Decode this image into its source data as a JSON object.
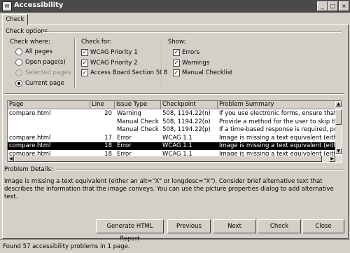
{
  "window": {
    "title": "Accessibility",
    "app_icon_text": "W",
    "controls": [
      "_",
      "□",
      "×"
    ]
  },
  "tab": {
    "label": "Check"
  },
  "check_options": {
    "header": "Check options",
    "check_where": {
      "header": "Check where:",
      "options": [
        {
          "label": "All pages",
          "selected": false,
          "enabled": true
        },
        {
          "label": "Open page(s)",
          "selected": false,
          "enabled": true
        },
        {
          "label": "Selected pages",
          "selected": false,
          "enabled": false
        },
        {
          "label": "Current page",
          "selected": true,
          "enabled": true
        }
      ]
    },
    "check_for": {
      "header": "Check for:",
      "options": [
        {
          "label": "WCAG Priority 1",
          "checked": true
        },
        {
          "label": "WCAG Priority 2",
          "checked": true
        },
        {
          "label": "Access Board Section 508",
          "checked": true
        }
      ]
    },
    "show": {
      "header": "Show:",
      "options": [
        {
          "label": "Errors",
          "checked": true
        },
        {
          "label": "Warnings",
          "checked": true
        },
        {
          "label": "Manual Checklist",
          "checked": true
        }
      ]
    }
  },
  "results": {
    "columns": [
      "Page",
      "Line",
      "Issue Type",
      "Checkpoint",
      "Problem Summary"
    ],
    "rows": [
      {
        "page": "compare.html",
        "line": "20",
        "issue": "Warning",
        "checkpoint": "508, 1194.22(n)",
        "summary": "If you use electronic forms, ensure that they ca",
        "selected": false
      },
      {
        "page": "",
        "line": "",
        "issue": "Manual Check",
        "checkpoint": "508, 1194.22(o)",
        "summary": "Provide a method for the user to skip these repe",
        "selected": false
      },
      {
        "page": "",
        "line": "",
        "issue": "Manual Check",
        "checkpoint": "508, 1194.22(p)",
        "summary": "If a time-based response is required, provide an",
        "selected": false
      },
      {
        "page": "compare.html",
        "line": "17",
        "issue": "Error",
        "checkpoint": "WCAG 1.1",
        "summary": "Image is missing a text equivalent (either an alt=",
        "selected": false
      },
      {
        "page": "compare.html",
        "line": "18",
        "issue": "Error",
        "checkpoint": "WCAG 1.1",
        "summary": "Image is missing a text equivalent (either an alt=",
        "selected": true
      },
      {
        "page": "compare.html",
        "line": "18",
        "issue": "Error",
        "checkpoint": "WCAG 1.1",
        "summary": "Image is missing a text equivalent (either an alt=",
        "selected": false
      }
    ]
  },
  "details": {
    "header": "Problem Details:",
    "text": "Image is missing a text equivalent (either an alt=\"X\" or longdesc=\"X\"). Consider brief alternative text that describes the information that the image conveys. You can use the picture properties dialog to add alternative text."
  },
  "buttons": {
    "generate": "Generate HTML Report",
    "previous": "Previous",
    "next": "Next",
    "check": "Check",
    "close": "Close"
  },
  "status": "Found 57 accessibility problems in 1 page.",
  "colors": {
    "titlebar": "#4a4a4a",
    "face": "#d4d0c8",
    "selection": "#000000"
  }
}
